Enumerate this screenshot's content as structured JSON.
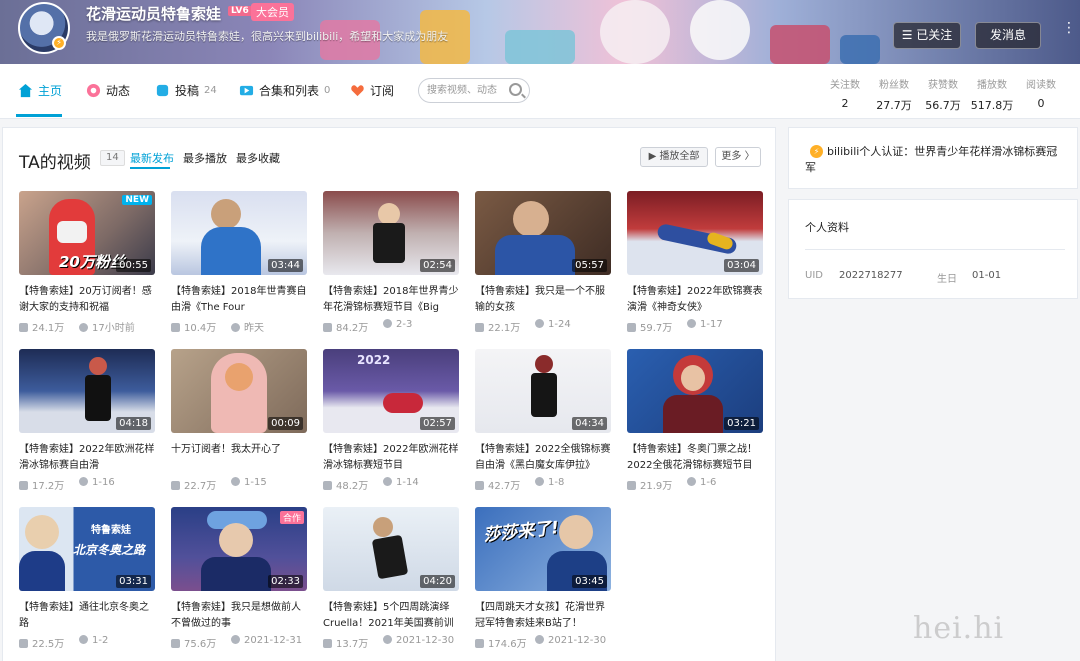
{
  "header": {
    "username": "花滑运动员特鲁索娃",
    "level": "LV6",
    "vip_badge": "大会员",
    "signature": "我是俄罗斯花滑运动员特鲁索娃，很高兴来到bilibili，希望和大家成为朋友",
    "follow_button": "已关注",
    "message_button": "发消息",
    "more_icon": "more-vertical-icon"
  },
  "nav": {
    "items": [
      {
        "label": "主页",
        "icon": "home-icon",
        "count": ""
      },
      {
        "label": "动态",
        "icon": "dynamic-icon",
        "count": ""
      },
      {
        "label": "投稿",
        "icon": "upload-icon",
        "count": "24"
      },
      {
        "label": "合集和列表",
        "icon": "collection-icon",
        "count": "0"
      },
      {
        "label": "订阅",
        "icon": "heart-icon",
        "count": ""
      }
    ],
    "search_placeholder": "搜索视频、动态",
    "stats": [
      {
        "label": "关注数",
        "value": "2"
      },
      {
        "label": "粉丝数",
        "value": "27.7万"
      },
      {
        "label": "获赞数",
        "value": "56.7万"
      },
      {
        "label": "播放数",
        "value": "517.8万"
      },
      {
        "label": "阅读数",
        "value": "0"
      }
    ]
  },
  "videos_section": {
    "title": "TA的视频",
    "count": "14",
    "sort_tabs": [
      "最新发布",
      "最多播放",
      "最多收藏"
    ],
    "play_all": "播放全部",
    "more": "更多",
    "videos": [
      {
        "title": "【特鲁索娃】20万订阅者！感谢大家的支持和祝福",
        "duration": "00:55",
        "views": "24.1万",
        "date": "17小时前",
        "tag": "NEW",
        "overlay": "20万粉丝"
      },
      {
        "title": "【特鲁索娃】2018年世青赛自由滑《The Four",
        "duration": "03:44",
        "views": "10.4万",
        "date": "昨天",
        "tag": "",
        "overlay": ""
      },
      {
        "title": "【特鲁索娃】2018年世界青少年花滑锦标赛短节目《Big",
        "duration": "02:54",
        "views": "84.2万",
        "date": "2-3",
        "tag": "",
        "overlay": ""
      },
      {
        "title": "【特鲁索娃】我只是一个不服输的女孩",
        "duration": "05:57",
        "views": "22.1万",
        "date": "1-24",
        "tag": "",
        "overlay": ""
      },
      {
        "title": "【特鲁索娃】2022年欧锦赛表演滑《神奇女侠》",
        "duration": "03:04",
        "views": "59.7万",
        "date": "1-17",
        "tag": "",
        "overlay": ""
      },
      {
        "title": "【特鲁索娃】2022年欧洲花样滑冰锦标赛自由滑",
        "duration": "04:18",
        "views": "17.2万",
        "date": "1-16",
        "tag": "",
        "overlay": ""
      },
      {
        "title": "十万订阅者！我太开心了",
        "duration": "00:09",
        "views": "22.7万",
        "date": "1-15",
        "tag": "",
        "overlay": ""
      },
      {
        "title": "【特鲁索娃】2022年欧洲花样滑冰锦标赛短节目",
        "duration": "02:57",
        "views": "48.2万",
        "date": "1-14",
        "tag": "",
        "overlay": "2022"
      },
      {
        "title": "【特鲁索娃】2022全俄锦标赛自由滑《黑白魔女库伊拉》",
        "duration": "04:34",
        "views": "42.7万",
        "date": "1-8",
        "tag": "",
        "overlay": ""
      },
      {
        "title": "【特鲁索娃】冬奥门票之战！2022全俄花滑锦标赛短节目",
        "duration": "03:21",
        "views": "21.9万",
        "date": "1-6",
        "tag": "",
        "overlay": ""
      },
      {
        "title": "【特鲁索娃】通往北京冬奥之路",
        "duration": "03:31",
        "views": "22.5万",
        "date": "1-2",
        "tag": "",
        "overlay": "北京冬奥之路",
        "overlay2": "特鲁索娃"
      },
      {
        "title": "【特鲁索娃】我只是想做前人不曾做过的事",
        "duration": "02:33",
        "views": "75.6万",
        "date": "2021-12-31",
        "tag": "合作",
        "overlay": ""
      },
      {
        "title": "【特鲁索娃】5个四周跳演绎Cruella！2021年美国赛前训",
        "duration": "04:20",
        "views": "13.7万",
        "date": "2021-12-30",
        "tag": "",
        "overlay": ""
      },
      {
        "title": "【四周跳天才女孩】花滑世界冠军特鲁索娃来B站了！",
        "duration": "03:45",
        "views": "174.6万",
        "date": "2021-12-30",
        "tag": "",
        "overlay": "莎莎来了!"
      }
    ]
  },
  "sidebar": {
    "certification": "bilibili个人认证：世界青少年花样滑冰锦标赛冠军",
    "profile_title": "个人资料",
    "uid_label": "UID",
    "uid_value": "2022718277",
    "birthday_label": "生日",
    "birthday_value": "01-01"
  },
  "colors": {
    "accent": "#00a1d6",
    "pink": "#fb7299"
  }
}
